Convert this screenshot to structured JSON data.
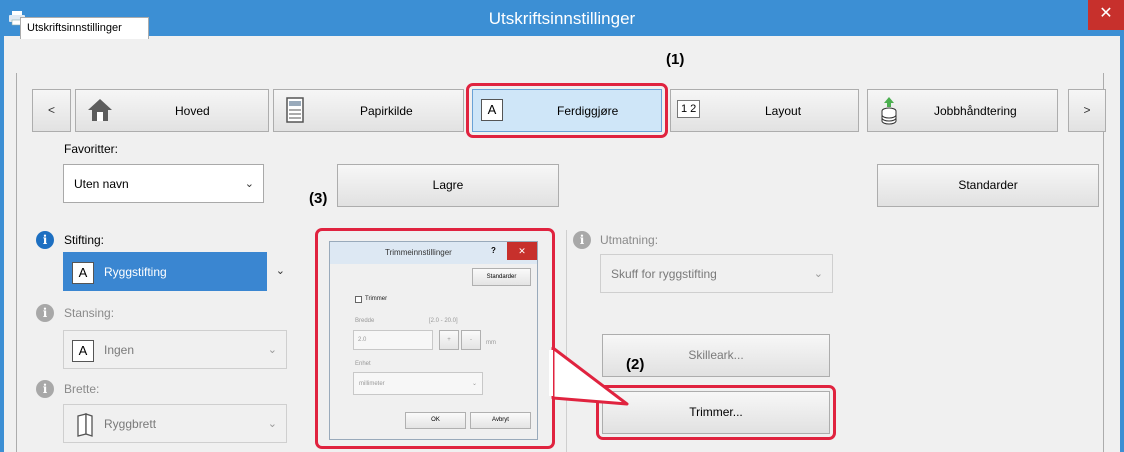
{
  "window": {
    "title": "Utskriftsinnstillinger",
    "close_icon": "✕",
    "app_icon": "printer-icon"
  },
  "tab": {
    "label": "Utskriftsinnstillinger"
  },
  "nav": {
    "prev": "<",
    "next": ">",
    "items": [
      {
        "label": "Hoved",
        "icon": "home-icon"
      },
      {
        "label": "Papirkilde",
        "icon": "paper-source-icon"
      },
      {
        "label": "Ferdiggjøre",
        "icon": "finishing-icon",
        "selected": true
      },
      {
        "label": "Layout",
        "icon": "layout-icon",
        "icon_text": "1 2"
      },
      {
        "label": "Jobbhåndtering",
        "icon": "job-handling-icon"
      }
    ]
  },
  "favorites": {
    "label": "Favoritter:",
    "value": "Uten navn",
    "save_label": "Lagre",
    "defaults_label": "Standarder"
  },
  "left": {
    "stapling": {
      "label": "Stifting:",
      "value": "Ryggstifting",
      "icon_text": "A"
    },
    "punching": {
      "label": "Stansing:",
      "value": "Ingen",
      "icon_text": "A"
    },
    "folding": {
      "label": "Brette:",
      "value": "Ryggbrett"
    }
  },
  "right": {
    "output": {
      "label": "Utmatning:",
      "value": "Skuff for ryggstifting"
    },
    "separator_label": "Skilleark...",
    "trimmer_label": "Trimmer..."
  },
  "callouts": {
    "one": "(1)",
    "two": "(2)",
    "three": "(3)"
  },
  "dialog": {
    "title": "Trimmeinnstillinger",
    "help": "?",
    "close": "✕",
    "defaults": "Standarder",
    "checkbox_label": "Trimmer",
    "width_label": "Bredde",
    "range": "[2.0 - 20.0]",
    "width_value": "2.0",
    "plus": "+",
    "minus": "-",
    "unit_short": "mm",
    "unit_label": "Enhet",
    "unit_value": "millimeter",
    "ok": "OK",
    "cancel": "Avbryt"
  },
  "colors": {
    "titlebar": "#3c8fd4",
    "highlight": "#e0233f",
    "selected_combo": "#3a86d1",
    "close": "#c7302c"
  }
}
